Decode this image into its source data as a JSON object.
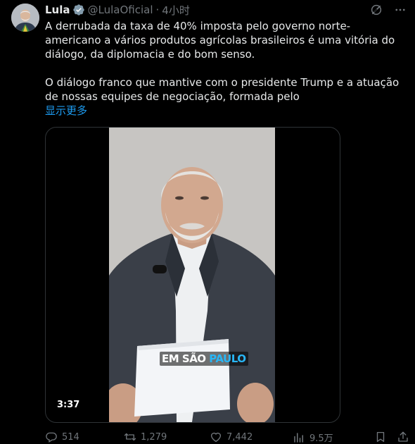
{
  "tweet": {
    "author_name": "Lula",
    "handle": "@LulaOficial",
    "separator": "·",
    "time": "4小时",
    "paragraphs": [
      "A derrubada da taxa de 40% imposta pelo governo norte-americano a vários produtos agrícolas brasileiros é uma vitória do diálogo, da diplomacia e do bom senso.",
      "O diálogo franco que mantive com o presidente Trump e a atuação de nossas equipes de negociação, formada pelo"
    ],
    "show_more": "显示更多"
  },
  "video": {
    "caption_white": "EM SÃO",
    "caption_blue": "PAULO",
    "duration": "3:37"
  },
  "actions": {
    "replies": "514",
    "reposts": "1,279",
    "likes": "7,442",
    "views": "9.5万"
  },
  "colors": {
    "background": "#000000",
    "text": "#e7e9ea",
    "muted": "#71767b",
    "link": "#1d9bf0",
    "verified": "#829aab",
    "caption_blue": "#29b6f6"
  },
  "icons": [
    "verified-badge-icon",
    "grok-icon",
    "more-icon",
    "reply-icon",
    "repost-icon",
    "like-icon",
    "views-icon",
    "bookmark-icon",
    "share-icon"
  ]
}
